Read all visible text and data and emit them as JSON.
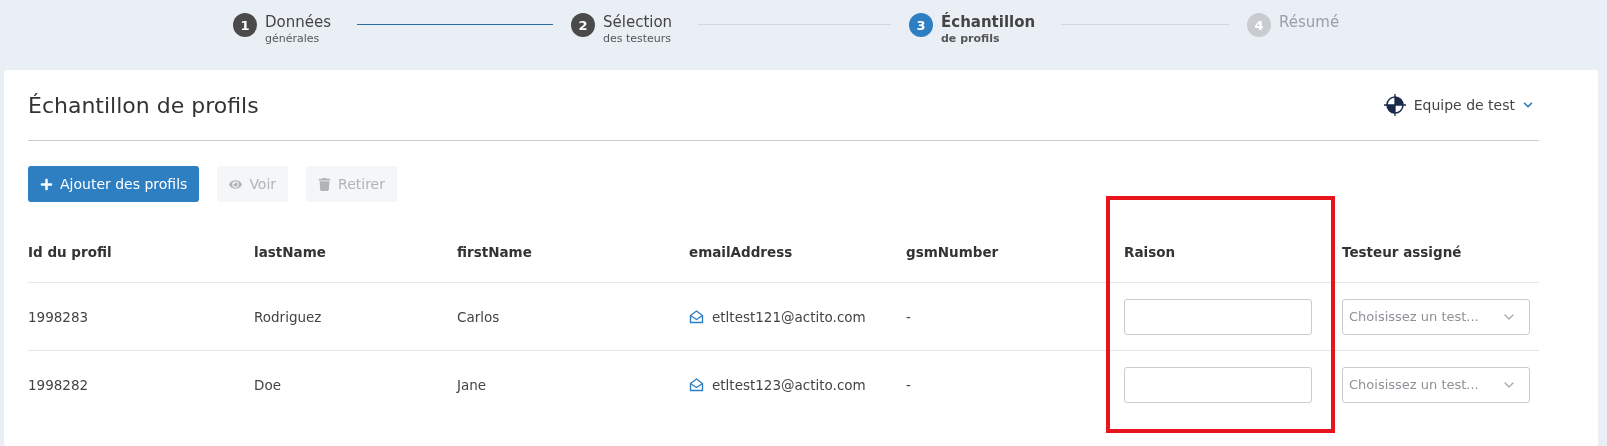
{
  "stepper": [
    {
      "number": "1",
      "title": "Données",
      "subtitle": "générales",
      "completed": true,
      "selected": false
    },
    {
      "number": "2",
      "title": "Sélection",
      "subtitle": "des testeurs",
      "completed": true,
      "selected": false
    },
    {
      "number": "3",
      "title": "Échantillon",
      "subtitle": "de profils",
      "completed": false,
      "selected": true
    },
    {
      "number": "4",
      "title": "Résumé",
      "completed": false,
      "selected": false
    }
  ],
  "page_title": "Échantillon de profils",
  "team_menu": {
    "label": "Equipe de test"
  },
  "toolbar": [
    {
      "kind": "add",
      "label": "Ajouter des profils",
      "disabled": false
    },
    {
      "kind": "view",
      "label": "Voir",
      "disabled": true
    },
    {
      "kind": "remove",
      "label": "Retirer",
      "disabled": true
    }
  ],
  "table": {
    "columns": [
      {
        "label": "Id du profil",
        "highlighted": false
      },
      {
        "label": "lastName",
        "highlighted": false
      },
      {
        "label": "firstName",
        "highlighted": false
      },
      {
        "label": "emailAddress",
        "highlighted": false
      },
      {
        "label": "gsmNumber",
        "highlighted": false
      },
      {
        "label": "Raison",
        "highlighted": true
      },
      {
        "label": "Testeur assigné",
        "highlighted": false
      }
    ],
    "rows": [
      {
        "id": "1998283",
        "last_name": "Rodriguez",
        "first_name": "Carlos",
        "email": "etltest121@actito.com",
        "gsm": "-",
        "tester_placeholder": "Choisissez un test..."
      },
      {
        "id": "1998282",
        "last_name": "Doe",
        "first_name": "Jane",
        "email": "etltest123@actito.com",
        "gsm": "-",
        "tester_placeholder": "Choisissez un test..."
      }
    ]
  }
}
